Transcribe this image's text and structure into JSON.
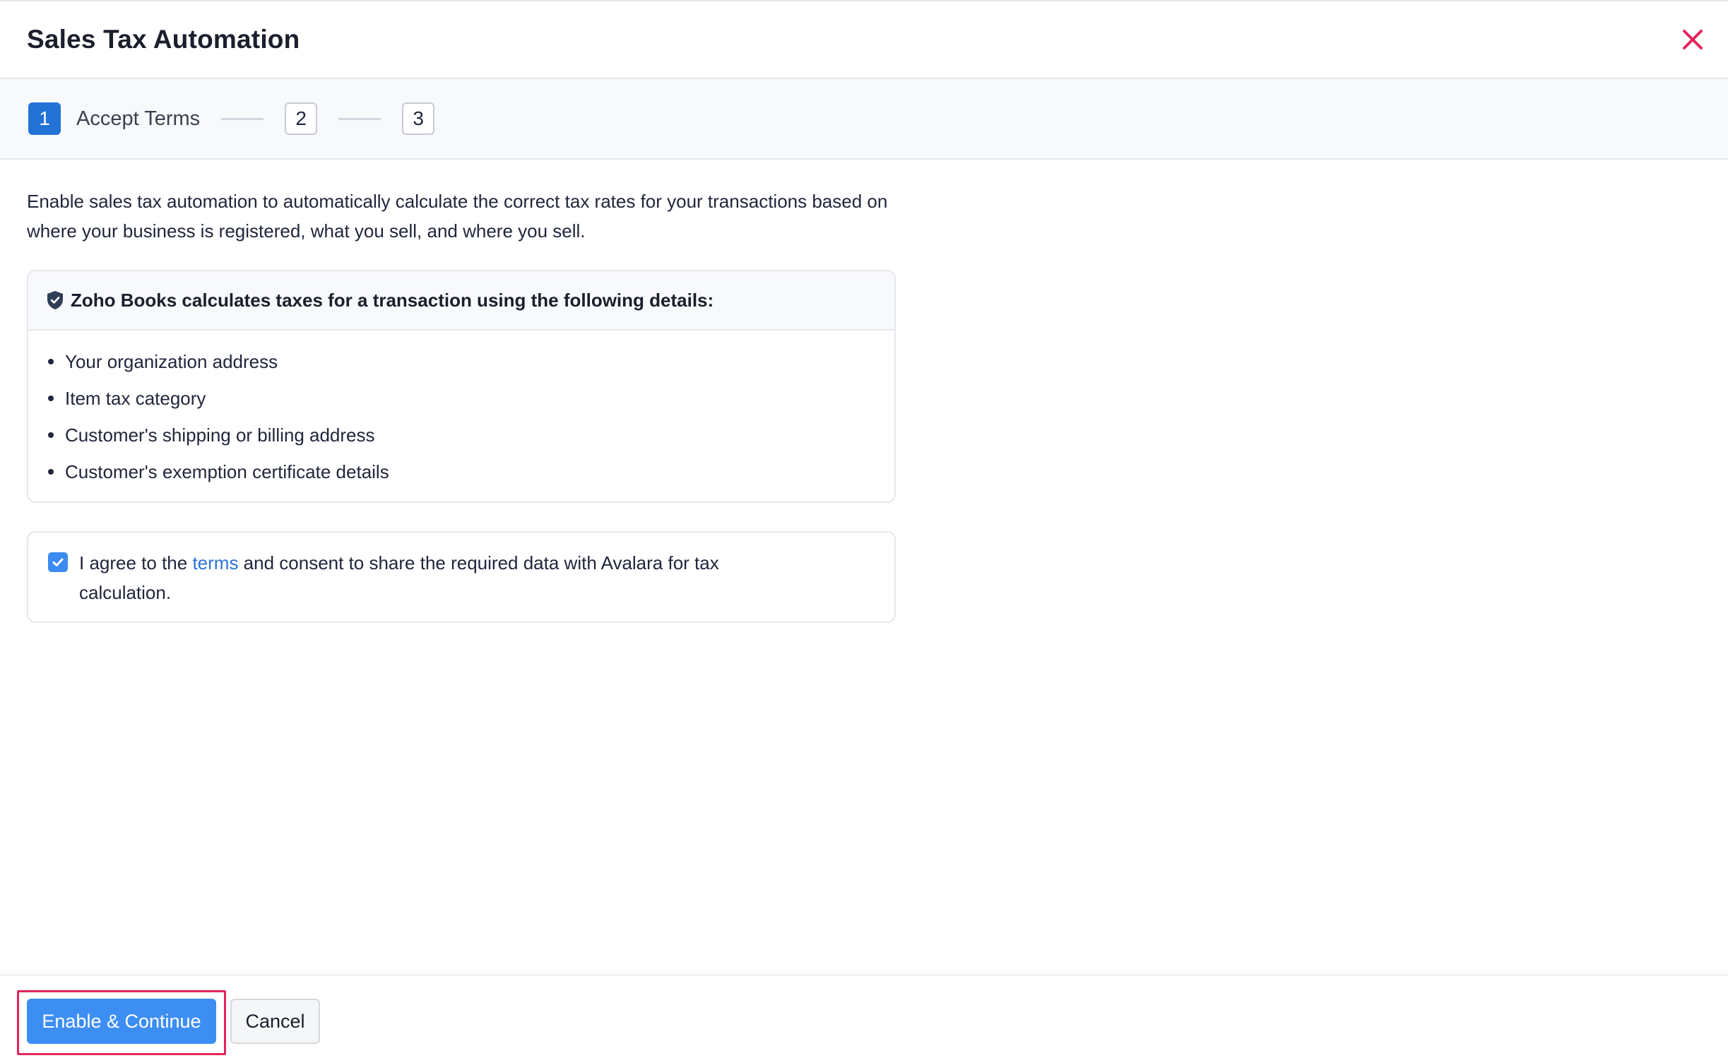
{
  "header": {
    "title": "Sales Tax Automation",
    "close_icon": "close-icon",
    "close_color": "#e3245c"
  },
  "stepper": {
    "steps": [
      {
        "number": "1",
        "label": "Accept Terms",
        "active": true
      },
      {
        "number": "2",
        "label": "",
        "active": false
      },
      {
        "number": "3",
        "label": "",
        "active": false
      }
    ]
  },
  "content": {
    "intro": "Enable sales tax automation to automatically calculate the correct tax rates for your transactions based on where your business is registered, what you sell, and where you sell.",
    "info_card": {
      "icon": "shield-check-icon",
      "heading": "Zoho Books calculates taxes for a transaction using the following details:",
      "items": [
        "Your organization address",
        "Item tax category",
        "Customer's shipping or billing address",
        "Customer's exemption certificate details"
      ]
    },
    "consent": {
      "checked": true,
      "text_before": "I agree to the ",
      "link_text": "terms",
      "text_after": " and consent to share the required data with Avalara for tax calculation."
    }
  },
  "footer": {
    "primary_label": "Enable & Continue",
    "secondary_label": "Cancel"
  },
  "colors": {
    "accent": "#2272d6",
    "primary_button": "#3d8ef2",
    "link": "#2a73d4",
    "highlight": "#e3245c"
  }
}
